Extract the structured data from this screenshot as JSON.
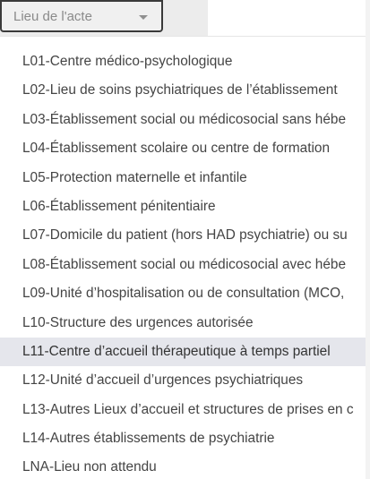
{
  "field": {
    "placeholder": "Lieu de l'acte",
    "icon": "chevron-down-icon"
  },
  "dropdown": {
    "selected_index": 10,
    "items": [
      {
        "label": "L01-Centre médico-psychologique"
      },
      {
        "label": "L02-Lieu de soins psychiatriques de l’établissement"
      },
      {
        "label": "L03-Établissement social ou médicosocial sans hébe"
      },
      {
        "label": "L04-Établissement scolaire ou centre de formation"
      },
      {
        "label": "L05-Protection maternelle et infantile"
      },
      {
        "label": "L06-Établissement pénitentiaire"
      },
      {
        "label": "L07-Domicile du patient (hors HAD psychiatrie) ou su"
      },
      {
        "label": "L08-Établissement social ou médicosocial avec hébe"
      },
      {
        "label": "L09-Unité d’hospitalisation ou de consultation (MCO,"
      },
      {
        "label": "L10-Structure des urgences autorisée"
      },
      {
        "label": "L11-Centre d’accueil thérapeutique à temps partiel"
      },
      {
        "label": "L12-Unité d’accueil d’urgences psychiatriques"
      },
      {
        "label": "L13-Autres Lieux d’accueil et structures de prises en c"
      },
      {
        "label": "L14-Autres établissements de psychiatrie"
      },
      {
        "label": "LNA-Lieu non attendu"
      }
    ]
  },
  "colors": {
    "text": "#444444",
    "selected_bg": "#e5e6ec",
    "border": "#3a3a3a",
    "placeholder": "#8a8a8a"
  }
}
